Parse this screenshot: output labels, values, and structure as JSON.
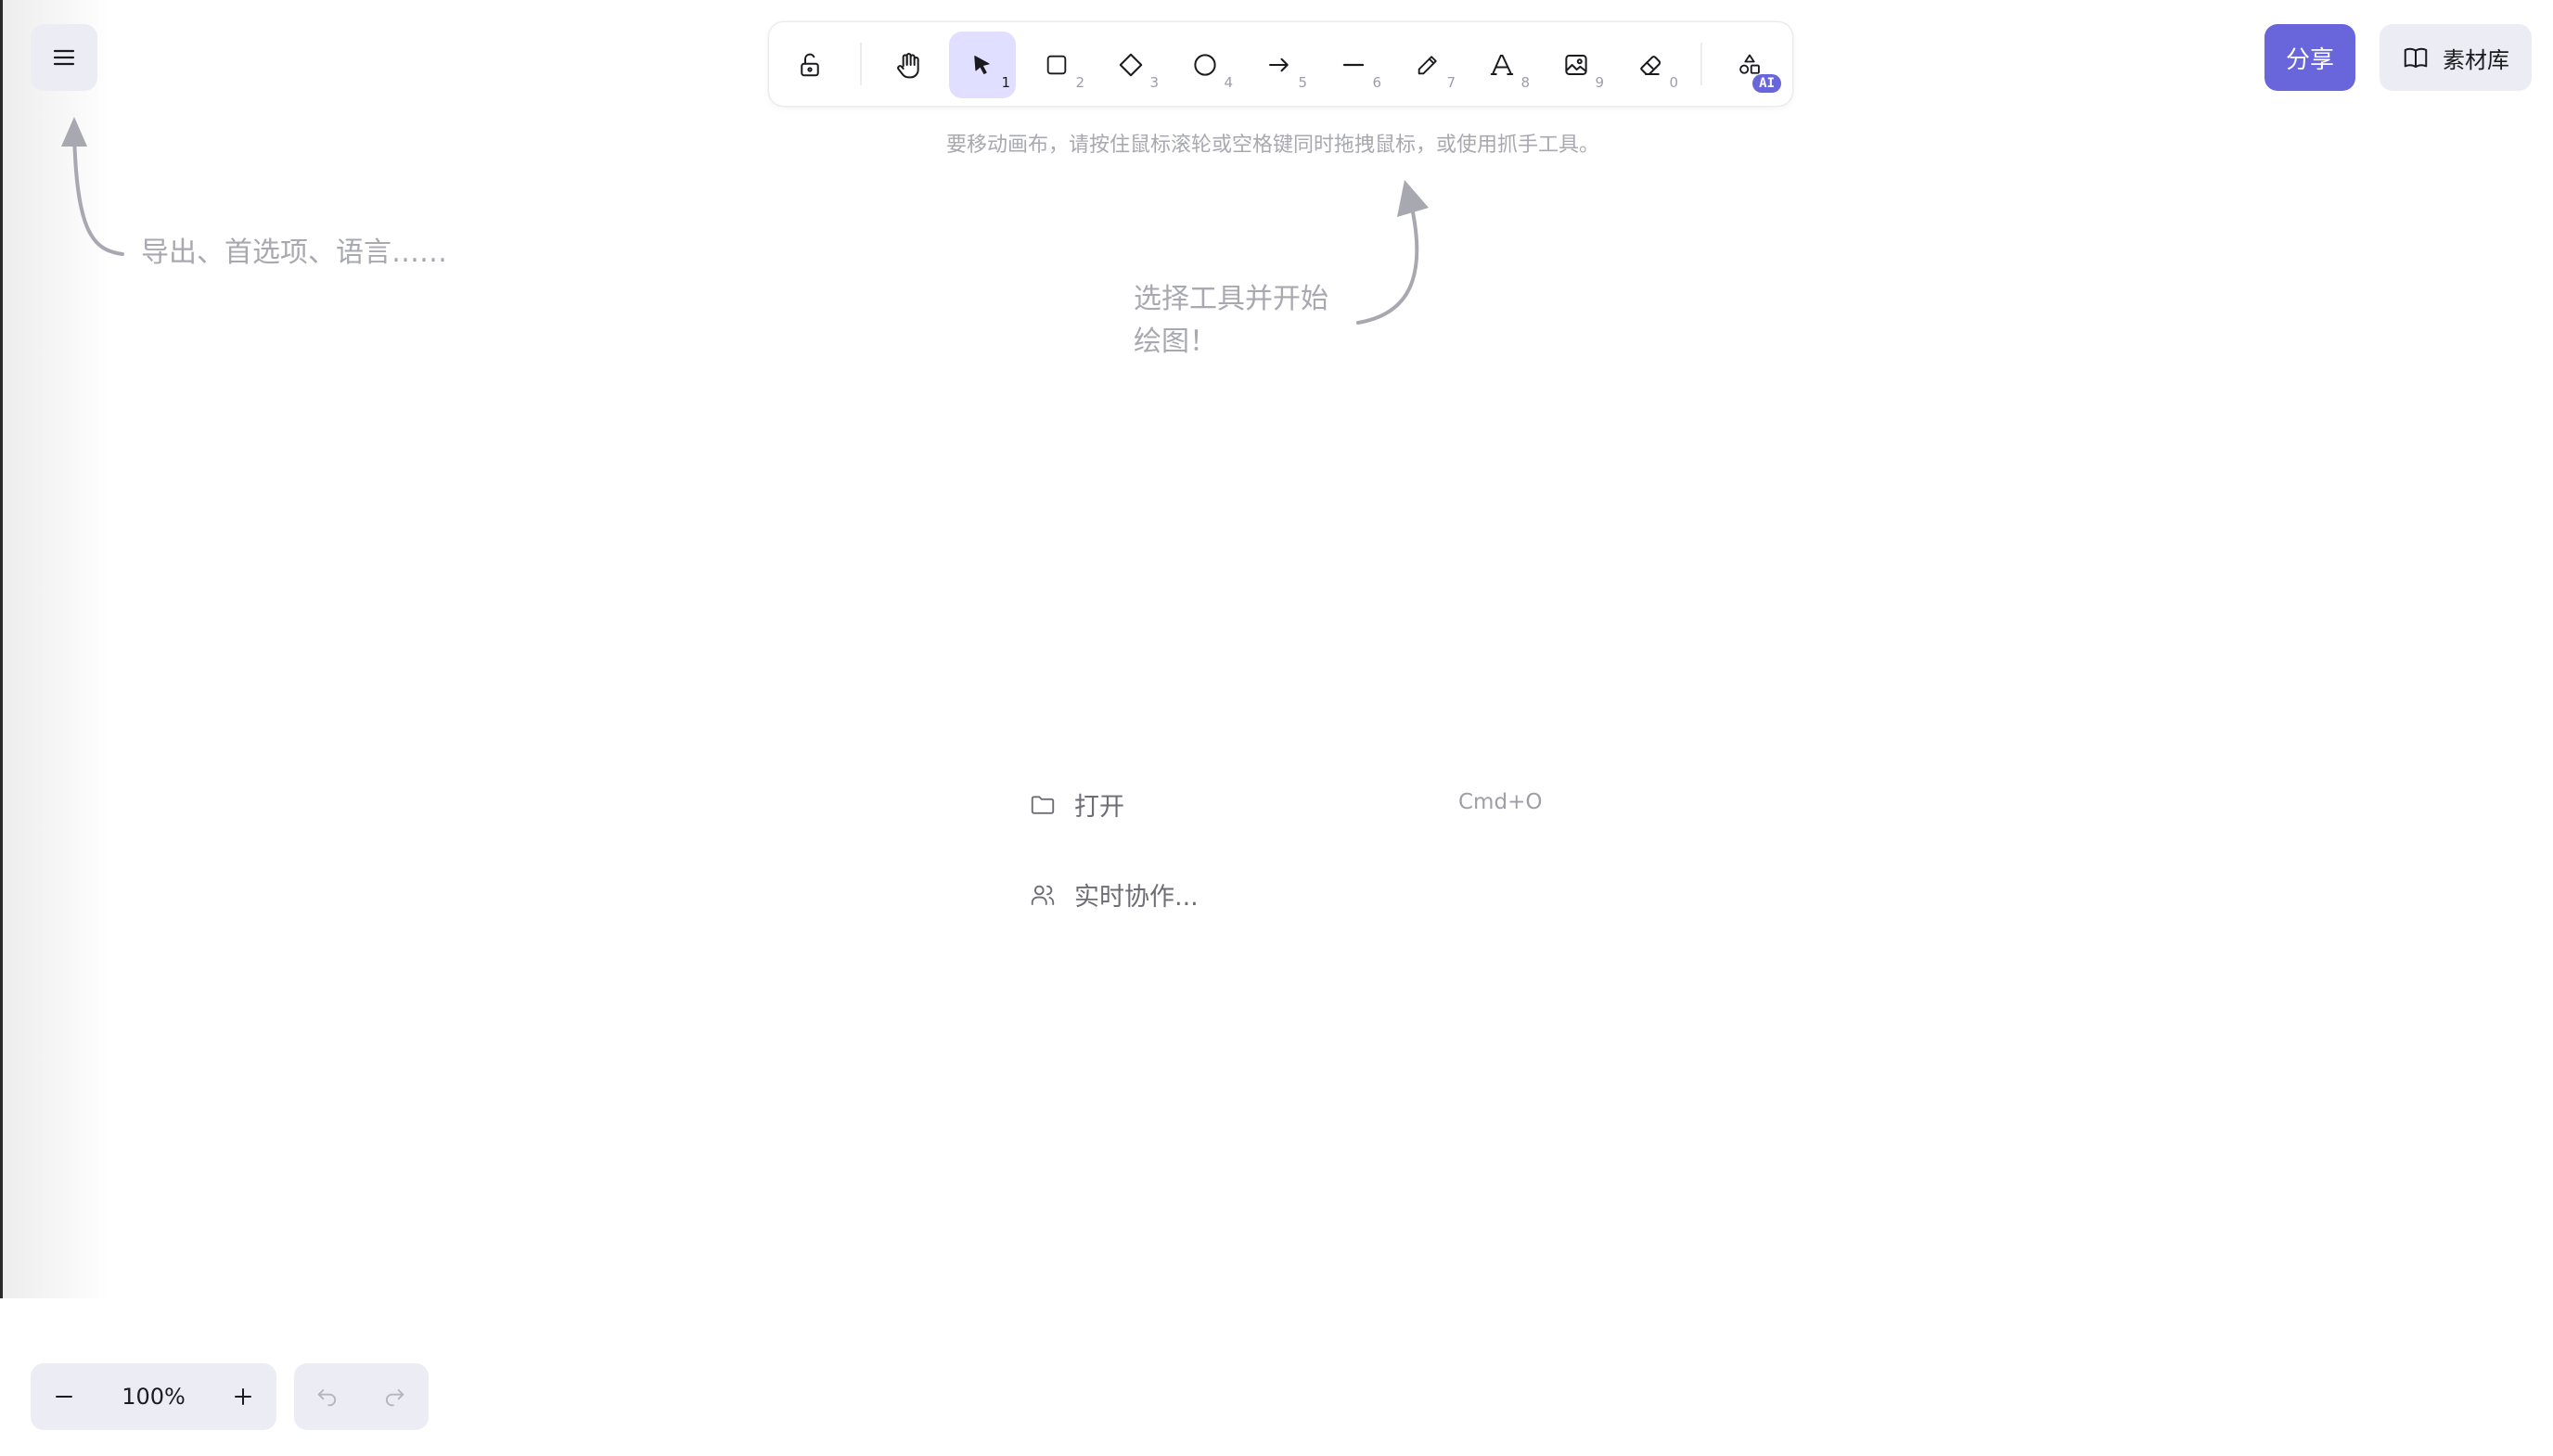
{
  "menu": {
    "icon": "hamburger-icon"
  },
  "toolbar": {
    "tools": [
      {
        "name": "lock",
        "icon": "unlock-icon",
        "key": ""
      },
      {
        "name": "hand",
        "icon": "hand-icon",
        "key": ""
      },
      {
        "name": "selection",
        "icon": "pointer-icon",
        "key": "1",
        "active": true
      },
      {
        "name": "rectangle",
        "icon": "rectangle-icon",
        "key": "2"
      },
      {
        "name": "diamond",
        "icon": "diamond-icon",
        "key": "3"
      },
      {
        "name": "ellipse",
        "icon": "ellipse-icon",
        "key": "4"
      },
      {
        "name": "arrow",
        "icon": "arrow-icon",
        "key": "5"
      },
      {
        "name": "line",
        "icon": "line-icon",
        "key": "6"
      },
      {
        "name": "draw",
        "icon": "pencil-icon",
        "key": "7"
      },
      {
        "name": "text",
        "icon": "text-icon",
        "key": "8"
      },
      {
        "name": "image",
        "icon": "image-icon",
        "key": "9"
      },
      {
        "name": "eraser",
        "icon": "eraser-icon",
        "key": "0"
      },
      {
        "name": "more-tools",
        "icon": "shapes-icon",
        "badge": "AI"
      }
    ],
    "accent": "#6965db",
    "active_bg": "#e0dfff"
  },
  "header_right": {
    "share_label": "分享",
    "library_label": "素材库"
  },
  "hints": {
    "canvas_move": "要移动画布，请按住鼠标滚轮或空格键同时拖拽鼠标，或使用抓手工具。",
    "menu_hint": "导出、首选项、语言……",
    "tool_hint_line1": "选择工具并开始",
    "tool_hint_line2": "绘图！"
  },
  "welcome": {
    "open_label": "打开",
    "open_shortcut": "Cmd+O",
    "collab_label": "实时协作..."
  },
  "footer": {
    "zoom_value": "100%",
    "zoom_out": "−",
    "zoom_in": "+"
  }
}
